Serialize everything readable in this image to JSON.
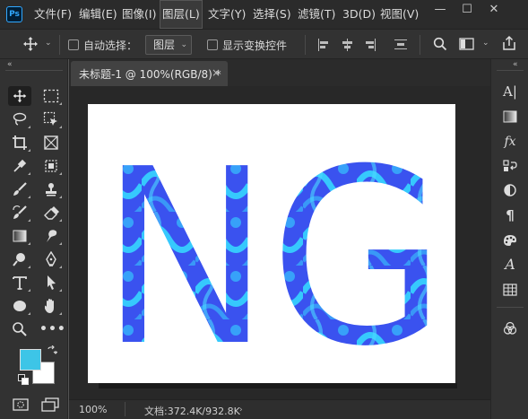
{
  "app": {
    "logo": "Ps"
  },
  "menu": {
    "items": [
      "文件(F)",
      "编辑(E)",
      "图像(I)",
      "图层(L)",
      "文字(Y)",
      "选择(S)",
      "滤镜(T)",
      "3D(D)",
      "视图(V)"
    ],
    "active_index": 3
  },
  "window_controls": {
    "minimize": "—",
    "restore": "☐",
    "close": "✕"
  },
  "options_bar": {
    "auto_select_label": "自动选择：",
    "auto_select_value": "图层",
    "transform_controls_label": "显示变换控件"
  },
  "document": {
    "tab_title": "未标题-1 @ 100%(RGB/8) *",
    "close_glyph": "×",
    "canvas_text": "NG"
  },
  "colors": {
    "foreground": "#3dc5e7",
    "background": "#ffffff",
    "text_fill_dark": "#3a4df0",
    "text_fill_light": "#35d6ff"
  },
  "status_bar": {
    "zoom": "100%",
    "doc_info": "文档:372.4K/932.8K"
  },
  "tools_left": [
    "move-tool-icon",
    "marquee-tool-icon",
    "lasso-tool-icon",
    "object-select-tool-icon",
    "crop-tool-icon",
    "frame-tool-icon",
    "eyedropper-tool-icon",
    "patch-tool-icon",
    "brush-tool-icon",
    "stamp-tool-icon",
    "history-brush-icon",
    "eraser-tool-icon",
    "gradient-tool-icon",
    "smudge-tool-icon",
    "dodge-tool-icon",
    "pen-tool-icon",
    "type-tool-icon",
    "path-select-tool-icon",
    "ellipse-tool-icon",
    "hand-tool-icon",
    "zoom-tool-icon",
    "more-tools-icon"
  ],
  "tools_right": [
    "character-panel-icon",
    "gradients-panel-icon",
    "styles-panel-icon",
    "properties-panel-icon",
    "adjustments-panel-icon",
    "paragraph-panel-icon",
    "swatches-panel-icon",
    "glyphs-panel-icon",
    "table-panel-icon",
    "channels-panel-icon"
  ]
}
